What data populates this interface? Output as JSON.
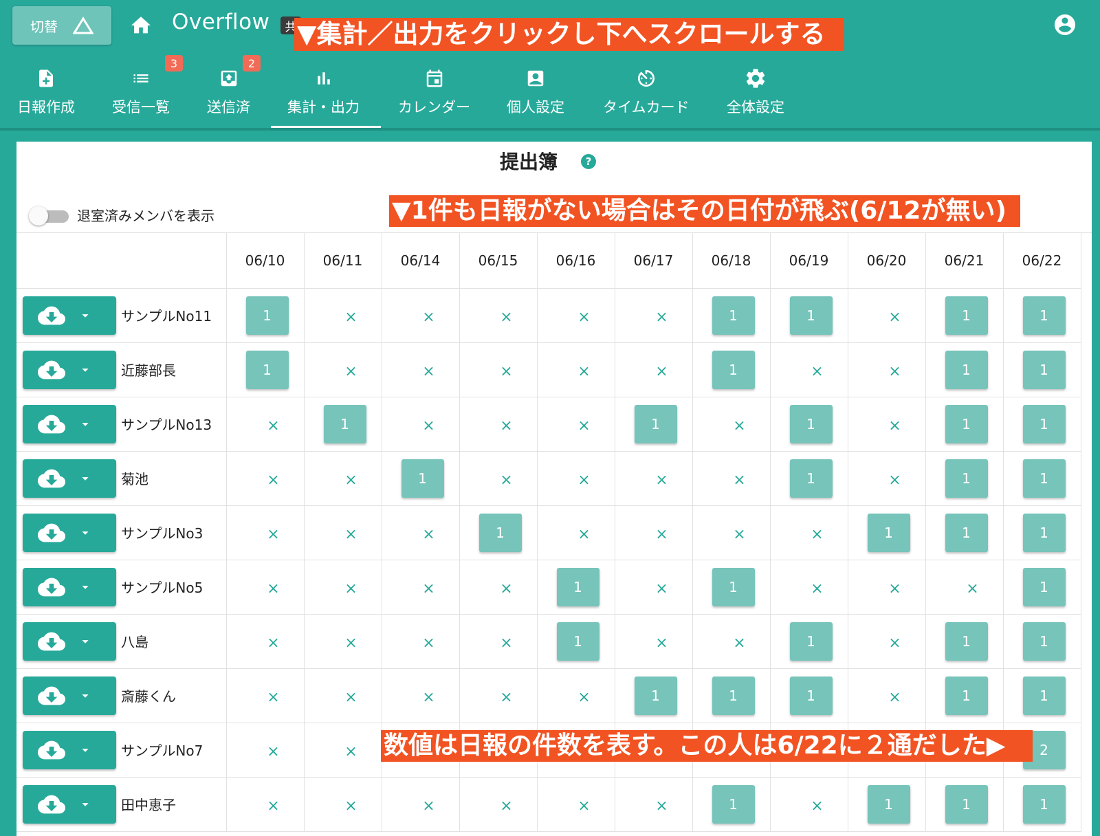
{
  "header": {
    "switch_label": "切替",
    "app_title": "Overflow",
    "share_badge": "共"
  },
  "nav": {
    "items": [
      {
        "label": "日報作成",
        "icon": "file-plus-icon",
        "badge": ""
      },
      {
        "label": "受信一覧",
        "icon": "list-icon",
        "badge": "3"
      },
      {
        "label": "送信済",
        "icon": "outbox-icon",
        "badge": "2"
      },
      {
        "label": "集計・出力",
        "icon": "bar-chart-icon",
        "badge": "",
        "active": true
      },
      {
        "label": "カレンダー",
        "icon": "calendar-icon",
        "badge": ""
      },
      {
        "label": "個人設定",
        "icon": "person-card-icon",
        "badge": ""
      },
      {
        "label": "タイムカード",
        "icon": "timer-icon",
        "badge": ""
      },
      {
        "label": "全体設定",
        "icon": "gear-icon",
        "badge": ""
      }
    ]
  },
  "panel": {
    "title": "提出簿",
    "toggle_label": "退室済みメンバを表示",
    "toggle_on": false
  },
  "table": {
    "dates": [
      "06/10",
      "06/11",
      "06/14",
      "06/15",
      "06/16",
      "06/17",
      "06/18",
      "06/19",
      "06/20",
      "06/21",
      "06/22"
    ],
    "rows": [
      {
        "name": "サンプルNo11",
        "cells": [
          "1",
          "×",
          "×",
          "×",
          "×",
          "×",
          "1",
          "1",
          "×",
          "1",
          "1"
        ]
      },
      {
        "name": "近藤部長",
        "cells": [
          "1",
          "×",
          "×",
          "×",
          "×",
          "×",
          "1",
          "×",
          "×",
          "1",
          "1"
        ]
      },
      {
        "name": "サンプルNo13",
        "cells": [
          "×",
          "1",
          "×",
          "×",
          "×",
          "1",
          "×",
          "1",
          "×",
          "1",
          "1"
        ]
      },
      {
        "name": "菊池",
        "cells": [
          "×",
          "×",
          "1",
          "×",
          "×",
          "×",
          "×",
          "1",
          "×",
          "1",
          "1"
        ]
      },
      {
        "name": "サンプルNo3",
        "cells": [
          "×",
          "×",
          "×",
          "1",
          "×",
          "×",
          "×",
          "×",
          "1",
          "1",
          "1"
        ]
      },
      {
        "name": "サンプルNo5",
        "cells": [
          "×",
          "×",
          "×",
          "×",
          "1",
          "×",
          "1",
          "×",
          "×",
          "×",
          "1"
        ]
      },
      {
        "name": "八島",
        "cells": [
          "×",
          "×",
          "×",
          "×",
          "1",
          "×",
          "×",
          "1",
          "×",
          "1",
          "1"
        ]
      },
      {
        "name": "斎藤くん",
        "cells": [
          "×",
          "×",
          "×",
          "×",
          "×",
          "1",
          "1",
          "1",
          "×",
          "1",
          "1"
        ]
      },
      {
        "name": "サンプルNo7",
        "cells": [
          "×",
          "×",
          "",
          "",
          "",
          "",
          "",
          "",
          "",
          "",
          "2"
        ]
      },
      {
        "name": "田中恵子",
        "cells": [
          "×",
          "×",
          "×",
          "×",
          "×",
          "×",
          "1",
          "×",
          "1",
          "1",
          "1"
        ]
      }
    ]
  },
  "annotations": {
    "top": "▼集計／出力をクリックし下へスクロールする",
    "middle": "▼1件も日報がない場合はその日付が飛ぶ(6/12が無い)",
    "bottom": "数値は日報の件数を表す。この人は6/22に２通だした▶"
  },
  "colors": {
    "primary": "#27a99a",
    "count_box": "#76c4ba",
    "annotation": "#f25322",
    "badge": "#f26b56"
  }
}
